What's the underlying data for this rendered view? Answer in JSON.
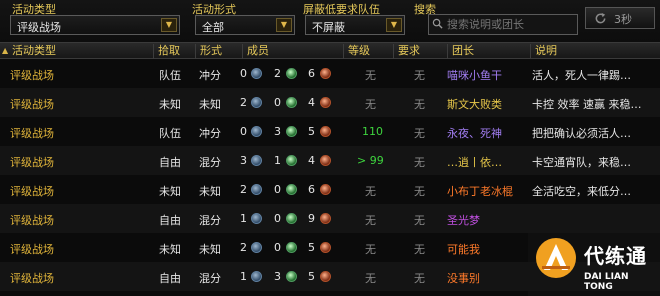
{
  "filters": {
    "type_label": "活动类型",
    "type_value": "评级战场",
    "mode_label": "活动形式",
    "mode_value": "全部",
    "block_label": "屏蔽低要求队伍",
    "block_value": "不屏蔽",
    "search_label": "搜索",
    "search_placeholder": "搜索说明或团长",
    "refresh_label": "3秒"
  },
  "columns": [
    "活动类型",
    "拾取",
    "形式",
    "成员",
    "等级",
    "要求",
    "团长",
    "说明"
  ],
  "rows": [
    {
      "type": "评级战场",
      "loot": "队伍",
      "mode": "冲分",
      "tank": "0",
      "heal": "2",
      "dps": "6",
      "level": "无",
      "req": "无",
      "leader": "喵咪小鱼干",
      "desc": "活人，死人一律踢…",
      "leader_color": "#a07cf0",
      "level_color": "#8a8a8a"
    },
    {
      "type": "评级战场",
      "loot": "未知",
      "mode": "未知",
      "tank": "2",
      "heal": "0",
      "dps": "4",
      "level": "无",
      "req": "无",
      "leader": "斯文大败类",
      "desc": "卡控 效率 速赢 来稳…",
      "leader_color": "#e8c84a",
      "level_color": "#8a8a8a"
    },
    {
      "type": "评级战场",
      "loot": "队伍",
      "mode": "冲分",
      "tank": "0",
      "heal": "3",
      "dps": "5",
      "level": "110",
      "req": "无",
      "leader": "永夜、死神",
      "desc": "把把确认必须活人…",
      "leader_color": "#a07cf0",
      "level_color": "#3ed43e"
    },
    {
      "type": "评级战场",
      "loot": "自由",
      "mode": "混分",
      "tank": "3",
      "heal": "1",
      "dps": "4",
      "level": "> 99",
      "req": "无",
      "leader": "…逍丨依…",
      "desc": "卡空通宵队，来稳…",
      "leader_color": "#e8c84a",
      "level_color": "#3ed43e"
    },
    {
      "type": "评级战场",
      "loot": "未知",
      "mode": "未知",
      "tank": "2",
      "heal": "0",
      "dps": "6",
      "level": "无",
      "req": "无",
      "leader": "小布丁老冰棍",
      "desc": "全活吃空，来低分…",
      "leader_color": "#ff7a2a",
      "level_color": "#8a8a8a"
    },
    {
      "type": "评级战场",
      "loot": "自由",
      "mode": "混分",
      "tank": "1",
      "heal": "0",
      "dps": "9",
      "level": "无",
      "req": "无",
      "leader": "圣光梦",
      "desc": "",
      "leader_color": "#c050e0",
      "level_color": "#8a8a8a"
    },
    {
      "type": "评级战场",
      "loot": "未知",
      "mode": "未知",
      "tank": "2",
      "heal": "0",
      "dps": "5",
      "level": "无",
      "req": "无",
      "leader": "可能我",
      "desc": "",
      "leader_color": "#ff7a2a",
      "level_color": "#8a8a8a"
    },
    {
      "type": "评级战场",
      "loot": "自由",
      "mode": "混分",
      "tank": "1",
      "heal": "3",
      "dps": "5",
      "level": "无",
      "req": "无",
      "leader": "没事别",
      "desc": "",
      "leader_color": "#ff7a2a",
      "level_color": "#8a8a8a"
    }
  ],
  "watermark": {
    "cn": "代练通",
    "en": "DAI LIAN TONG"
  }
}
